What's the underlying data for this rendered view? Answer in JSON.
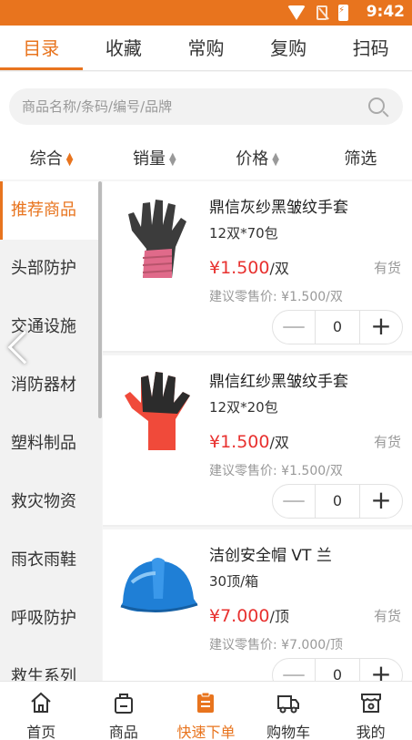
{
  "status": {
    "time": "9:42"
  },
  "tabs": [
    {
      "label": "目录"
    },
    {
      "label": "收藏"
    },
    {
      "label": "常购"
    },
    {
      "label": "复购"
    },
    {
      "label": "扫码"
    }
  ],
  "search": {
    "placeholder": "商品名称/条码/编号/品牌"
  },
  "sort": [
    {
      "label": "综合"
    },
    {
      "label": "销量"
    },
    {
      "label": "价格"
    },
    {
      "label": "筛选"
    }
  ],
  "categories": [
    {
      "label": "推荐商品"
    },
    {
      "label": "头部防护"
    },
    {
      "label": "交通设施"
    },
    {
      "label": "消防器材"
    },
    {
      "label": "塑料制品"
    },
    {
      "label": "救灾物资"
    },
    {
      "label": "雨衣雨鞋"
    },
    {
      "label": "呼吸防护"
    },
    {
      "label": "救生系列"
    }
  ],
  "products": [
    {
      "name": "鼎信灰纱黑皱纹手套",
      "spec": "12双*70包",
      "price": "¥1.500",
      "unit": "/双",
      "stock": "有货",
      "suggested": "建议零售价: ¥1.500/双",
      "qty": "0",
      "image": "gray-glove"
    },
    {
      "name": "鼎信红纱黑皱纹手套",
      "spec": "12双*20包",
      "price": "¥1.500",
      "unit": "/双",
      "stock": "有货",
      "suggested": "建议零售价: ¥1.500/双",
      "qty": "0",
      "image": "red-glove"
    },
    {
      "name": "洁创安全帽 VT 兰",
      "spec": "30顶/箱",
      "price": "¥7.000",
      "unit": "/顶",
      "stock": "有货",
      "suggested": "建议零售价: ¥7.000/顶",
      "qty": "0",
      "image": "blue-helmet"
    }
  ],
  "stepper": {
    "minus": "—",
    "plus": "+"
  },
  "bottom_nav": [
    {
      "label": "首页",
      "icon": "home-icon"
    },
    {
      "label": "商品",
      "icon": "bag-icon"
    },
    {
      "label": "快速下单",
      "icon": "clipboard-icon"
    },
    {
      "label": "购物车",
      "icon": "truck-icon"
    },
    {
      "label": "我的",
      "icon": "store-icon"
    }
  ],
  "colors": {
    "accent": "#e8741e",
    "price": "#e8312f"
  }
}
